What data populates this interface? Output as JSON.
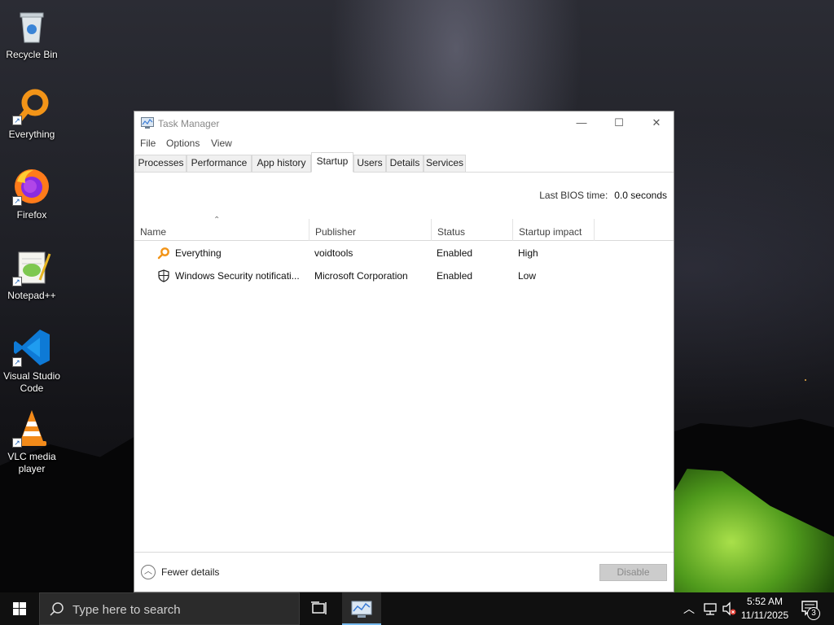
{
  "desktop": {
    "icons": [
      {
        "label": "Recycle Bin",
        "icon": "recycle-bin-icon"
      },
      {
        "label": "Everything",
        "icon": "everything-search-icon"
      },
      {
        "label": "Firefox",
        "icon": "firefox-icon"
      },
      {
        "label": "Notepad++",
        "icon": "notepad-plus-plus-icon"
      },
      {
        "label": "Visual Studio Code",
        "icon": "vscode-icon"
      },
      {
        "label": "VLC media player",
        "icon": "vlc-icon"
      }
    ]
  },
  "task_manager": {
    "title": "Task Manager",
    "menu": [
      "File",
      "Options",
      "View"
    ],
    "tabs": [
      "Processes",
      "Performance",
      "App history",
      "Startup",
      "Users",
      "Details",
      "Services"
    ],
    "active_tab": "Startup",
    "bios_label": "Last BIOS time:",
    "bios_value": "0.0 seconds",
    "columns": [
      "Name",
      "Publisher",
      "Status",
      "Startup impact"
    ],
    "rows": [
      {
        "name": "Everything",
        "publisher": "voidtools",
        "status": "Enabled",
        "impact": "High",
        "icon": "everything-search-icon"
      },
      {
        "name": "Windows Security notificati...",
        "publisher": "Microsoft Corporation",
        "status": "Enabled",
        "impact": "Low",
        "icon": "shield-icon"
      }
    ],
    "fewer_details": "Fewer details",
    "disable_button": "Disable"
  },
  "taskbar": {
    "search_placeholder": "Type here to search",
    "time": "5:52 AM",
    "date": "11/11/2025",
    "notification_count": "3"
  },
  "colors": {
    "accent": "#76b9ed",
    "everything_orange": "#f29418",
    "vscode_blue": "#0e7ad6",
    "tent_green": "#8ccf35"
  }
}
